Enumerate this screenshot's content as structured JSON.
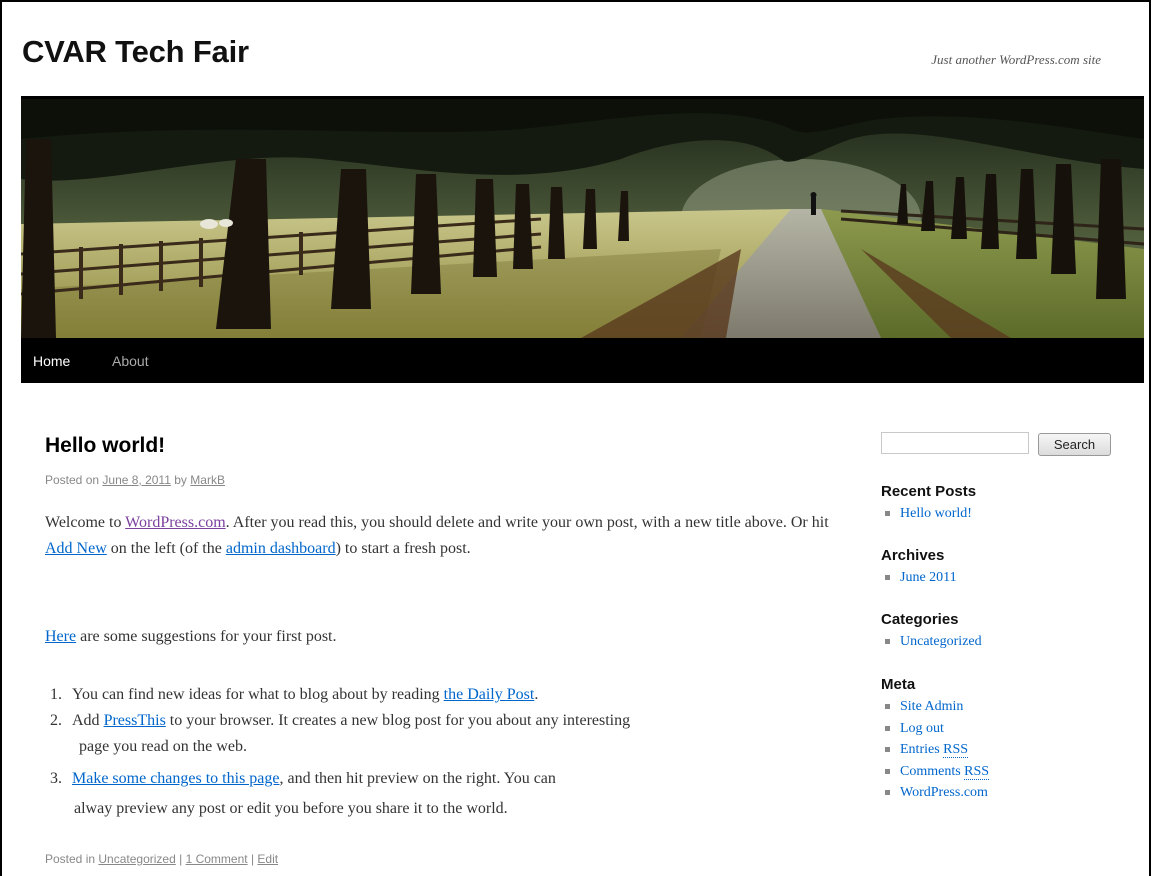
{
  "site": {
    "title": "CVAR Tech Fair",
    "tagline": "Just another WordPress.com site"
  },
  "nav": {
    "items": [
      {
        "label": "Home"
      },
      {
        "label": "About"
      }
    ]
  },
  "post": {
    "title": "Hello world!",
    "meta": {
      "posted_on": "Posted on",
      "date": "June 8, 2011",
      "by": "by",
      "author": "MarkB"
    },
    "p1": {
      "t1": "Welcome to ",
      "link1": "WordPress.com",
      "t2": ". After you read this, you should delete and write your own post, with a new title above. Or hit ",
      "link2": "Add New",
      "t3": " on the left (of the ",
      "link3": "admin dashboard",
      "t4": ") to start a fresh post."
    },
    "p2": {
      "link": "Here",
      "text": " are some suggestions for your first post."
    },
    "list": [
      {
        "num": "1.",
        "t1": "You can find new ideas for what to blog about by reading ",
        "link": "the Daily Post",
        "t2": "."
      },
      {
        "num": "2.",
        "t1": "Add ",
        "link": "PressThis",
        "t2": " to your browser. It creates a new blog post for you about any interesting",
        "cont": "page you read on the web."
      },
      {
        "num": "3.",
        "link": "Make some changes to this page",
        "t2": ", and then hit preview on the right. You can",
        "cont": "alway preview any post or edit you before you share it to the world."
      }
    ],
    "footer": {
      "posted_in": "Posted in",
      "category": "Uncategorized",
      "sep1": " | ",
      "comments": "1 Comment",
      "sep2": " | ",
      "edit": "Edit"
    }
  },
  "sidebar": {
    "search": {
      "placeholder": "",
      "button": "Search"
    },
    "recent_posts": {
      "title": "Recent Posts",
      "items": [
        "Hello world!"
      ]
    },
    "archives": {
      "title": "Archives",
      "items": [
        "June 2011"
      ]
    },
    "categories": {
      "title": "Categories",
      "items": [
        "Uncategorized"
      ]
    },
    "meta": {
      "title": "Meta",
      "items": [
        {
          "label": "Site Admin"
        },
        {
          "label": "Log out"
        },
        {
          "pre": "Entries ",
          "abbr": "RSS"
        },
        {
          "pre": "Comments ",
          "abbr": "RSS"
        },
        {
          "label": "WordPress.com"
        }
      ]
    }
  },
  "colors": {
    "link": "#0066cc",
    "visited_link": "#7b3f9e",
    "nav_bg": "#000000",
    "meta_text": "#888888"
  }
}
